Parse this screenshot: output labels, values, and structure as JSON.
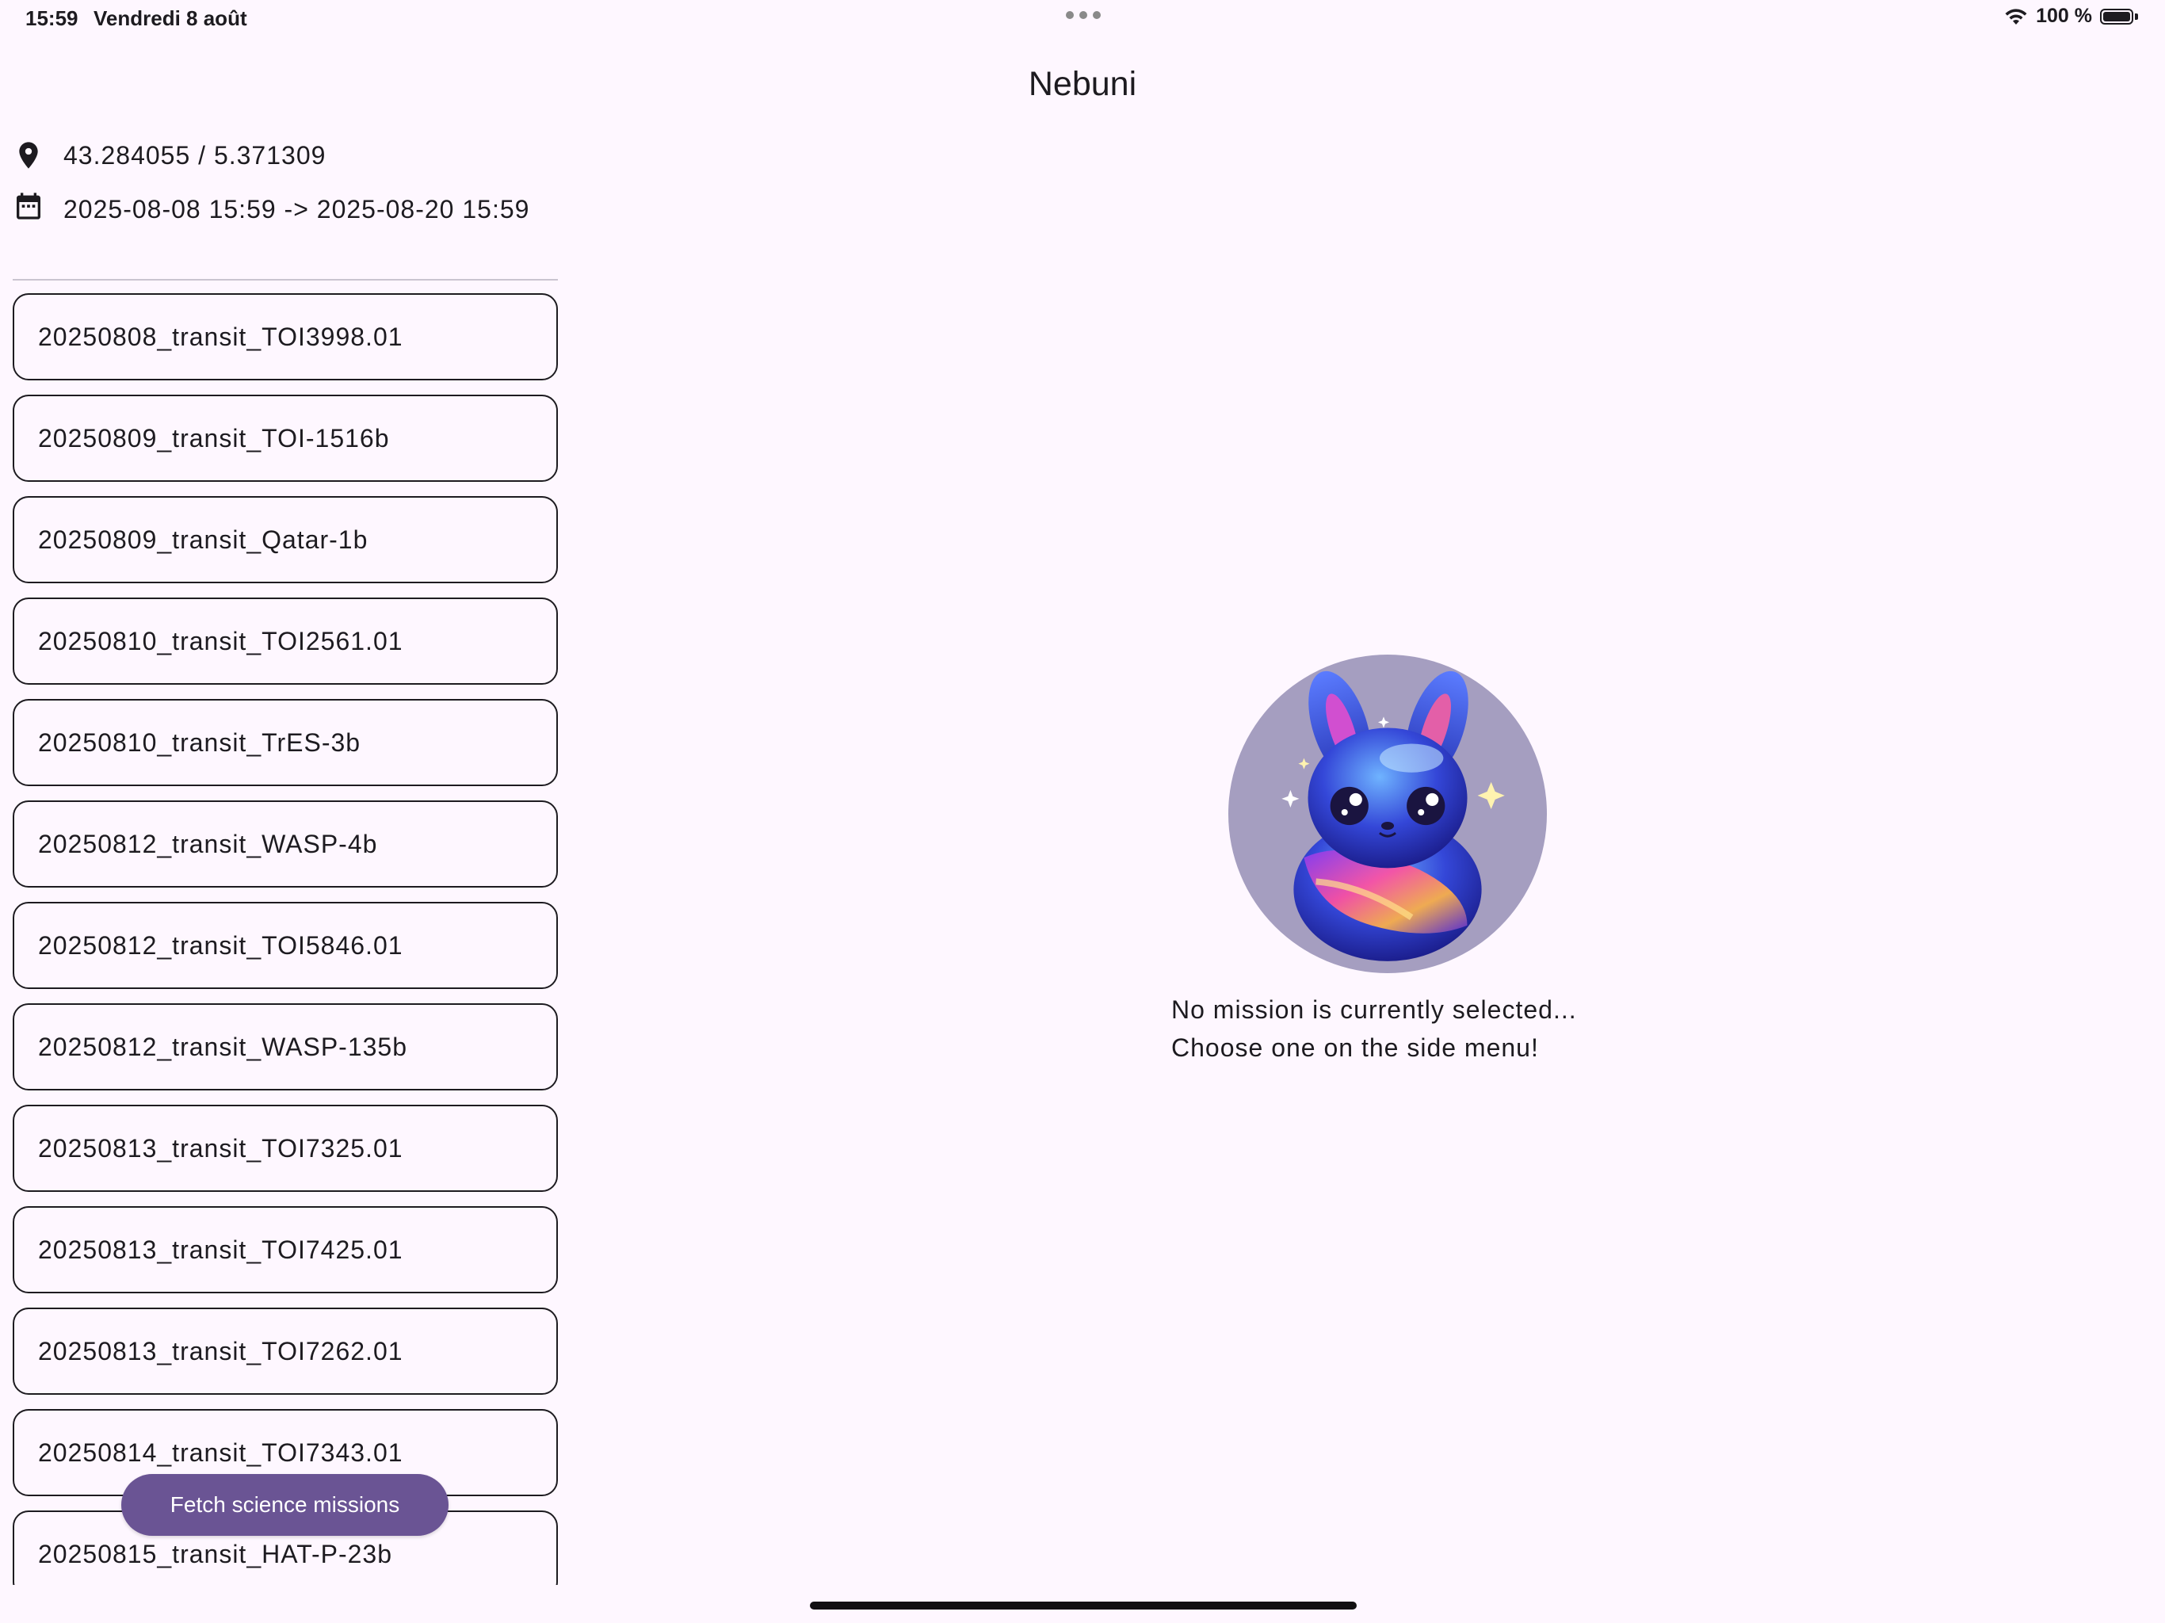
{
  "status_bar": {
    "time": "15:59",
    "date": "Vendredi 8 août",
    "battery": "100 %"
  },
  "app": {
    "title": "Nebuni"
  },
  "sidebar": {
    "location": "43.284055 / 5.371309",
    "date_range": "2025-08-08 15:59 -> 2025-08-20 15:59",
    "missions": [
      "20250808_transit_TOI3998.01",
      "20250809_transit_TOI-1516b",
      "20250809_transit_Qatar-1b",
      "20250810_transit_TOI2561.01",
      "20250810_transit_TrES-3b",
      "20250812_transit_WASP-4b",
      "20250812_transit_TOI5846.01",
      "20250812_transit_WASP-135b",
      "20250813_transit_TOI7325.01",
      "20250813_transit_TOI7425.01",
      "20250813_transit_TOI7262.01",
      "20250814_transit_TOI7343.01",
      "20250815_transit_HAT-P-23b"
    ],
    "fetch_button_label": "Fetch science missions"
  },
  "main": {
    "empty_line1": "No mission is currently selected...",
    "empty_line2": "Choose one on the side menu!"
  },
  "colors": {
    "background": "#fef7ff",
    "accent": "#6a5494",
    "mascot_circle": "#a59ec0"
  },
  "icons": {
    "location": "location-pin-icon",
    "calendar": "calendar-icon",
    "wifi": "wifi-icon",
    "battery": "battery-icon"
  }
}
